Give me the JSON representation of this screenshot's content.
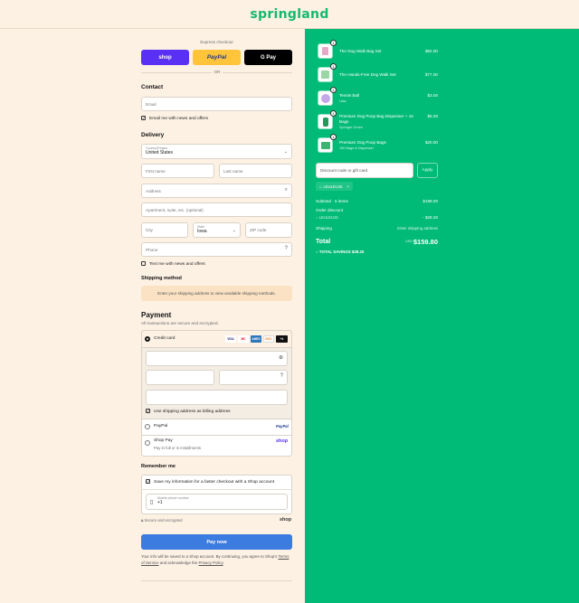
{
  "brand": {
    "name": "springland"
  },
  "express": {
    "label": "Express checkout",
    "shop": "shop",
    "paypal": "PayPal",
    "gpay": "G Pay",
    "or": "OR"
  },
  "contact": {
    "title": "Contact",
    "email_placeholder": "Email",
    "email_news": "Email me with news and offers"
  },
  "delivery": {
    "title": "Delivery",
    "country_label": "Country/Region",
    "country_value": "United States",
    "first_name": "First name",
    "last_name": "Last name",
    "address": "Address",
    "apartment": "Apartment, suite, etc. (optional)",
    "city": "City",
    "state_label": "State",
    "state_value": "Iowa",
    "zip": "ZIP code",
    "phone": "Phone",
    "text_news": "Text me with news and offers"
  },
  "shipping": {
    "title": "Shipping method",
    "note": "Enter your shipping address to view available shipping methods."
  },
  "payment": {
    "title": "Payment",
    "subtitle": "All transactions are secure and encrypted.",
    "credit_card": "Credit card",
    "cards": [
      "VISA",
      "MC",
      "AMEX",
      "DISC",
      "+4"
    ],
    "billing_same": "Use shipping address as billing address",
    "paypal": "PayPal",
    "paypal_logo": "PayPal",
    "shop_pay": "Shop Pay",
    "shop_pay_sub": "Pay in full or in installments",
    "shop_logo": "shop"
  },
  "remember": {
    "title": "Remember me",
    "save_info": "Save my information for a faster checkout with a Shop account",
    "mobile_label": "Mobile phone number",
    "mobile_value": "+1"
  },
  "footer": {
    "secure": "Secure and encrypted",
    "shop_logo": "shop",
    "pay_now": "Pay now",
    "legal_1": "Your info will be saved to a Shop account. By continuing, you agree to Shop's",
    "terms": "Terms of Service",
    "legal_2": "and acknowledge the",
    "privacy": "Privacy Policy",
    "legal_3": "."
  },
  "order": {
    "items": [
      {
        "name": "The Dog Walk Bag Set",
        "sub": "",
        "price": "$82.00",
        "qty": "1"
      },
      {
        "name": "The Hands-Free Dog Walk Set",
        "sub": "",
        "price": "$77.00",
        "qty": "1"
      },
      {
        "name": "Tennis Ball",
        "sub": "Lilac",
        "price": "$3.00",
        "qty": "1"
      },
      {
        "name": "Premium Dog Poop Bag Dispenser + 15 Bags",
        "sub": "Springer Green",
        "price": "$6.00",
        "qty": "1"
      },
      {
        "name": "Premium Dog Poop Bags",
        "sub": "150 Bags w Dispenser",
        "price": "$20.00",
        "qty": "1"
      }
    ],
    "discount_placeholder": "Discount code or gift card",
    "apply": "Apply",
    "code_chip": "LEULEU15",
    "subtotal_label": "Subtotal · 5 items",
    "subtotal": "$188.00",
    "discount_label": "Order discount",
    "discount_code": "LEULEU15",
    "discount_value": "- $28.20",
    "shipping_label": "Shipping",
    "shipping_value": "Enter shipping address",
    "total_label": "Total",
    "currency": "USD",
    "total": "$159.80",
    "savings_label": "TOTAL SAVINGS",
    "savings": "$28.20"
  },
  "colors": {
    "accent": "#00ba78",
    "shop_purple": "#5a31f4",
    "paypal_yellow": "#ffc439",
    "pay_button": "#3c7bdf"
  }
}
